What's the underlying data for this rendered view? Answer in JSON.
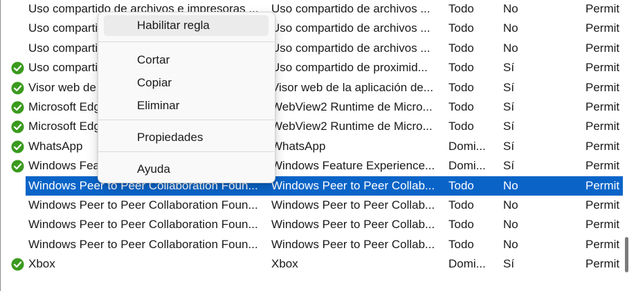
{
  "rule_list": {
    "rows": [
      {
        "name": "Uso compartido de archivos e impresoras ...",
        "group": "Uso compartido de archivos ...",
        "profile": "Todo",
        "enabled": "No",
        "action": "Permit",
        "enabled_icon": "",
        "selected": false
      },
      {
        "name": "Uso compartido de archivos e impresoras ...",
        "group": "Uso compartido de archivos ...",
        "profile": "Todo",
        "enabled": "No",
        "action": "Permit",
        "enabled_icon": "",
        "selected": false
      },
      {
        "name": "Uso compartido de archivos e impresoras ...",
        "group": "Uso compartido de archivos ...",
        "profile": "Todo",
        "enabled": "No",
        "action": "Permit",
        "enabled_icon": "",
        "selected": false
      },
      {
        "name": "Uso compartido de proximidad ...",
        "group": "Uso compartido de proximid...",
        "profile": "Todo",
        "enabled": "Sí",
        "action": "Permit",
        "enabled_icon": "green-check-icon",
        "selected": false
      },
      {
        "name": "Visor web de la aplicación de escritorio",
        "group": "Visor web de la aplicación de...",
        "profile": "Todo",
        "enabled": "Sí",
        "action": "Permit",
        "enabled_icon": "green-check-icon",
        "selected": false
      },
      {
        "name": "Microsoft Edge WebView2",
        "group": "WebView2 Runtime de Micro...",
        "profile": "Todo",
        "enabled": "Sí",
        "action": "Permit",
        "enabled_icon": "green-check-icon",
        "selected": false
      },
      {
        "name": "Microsoft Edge WebView2",
        "group": "WebView2 Runtime de Micro...",
        "profile": "Todo",
        "enabled": "Sí",
        "action": "Permit",
        "enabled_icon": "green-check-icon",
        "selected": false
      },
      {
        "name": "WhatsApp",
        "group": "WhatsApp",
        "profile": "Domi...",
        "enabled": "Sí",
        "action": "Permit",
        "enabled_icon": "green-check-icon",
        "selected": false
      },
      {
        "name": "Windows Feature Experience Pack",
        "group": "Windows Feature Experience...",
        "profile": "Domi...",
        "enabled": "Sí",
        "action": "Permit",
        "enabled_icon": "green-check-icon",
        "selected": false
      },
      {
        "name": "Windows Peer to Peer Collaboration Foun...",
        "group": "Windows Peer to Peer Collab...",
        "profile": "Todo",
        "enabled": "No",
        "action": "Permit",
        "enabled_icon": "",
        "selected": true
      },
      {
        "name": "Windows Peer to Peer Collaboration Foun...",
        "group": "Windows Peer to Peer Collab...",
        "profile": "Todo",
        "enabled": "No",
        "action": "Permit",
        "enabled_icon": "",
        "selected": false
      },
      {
        "name": "Windows Peer to Peer Collaboration Foun...",
        "group": "Windows Peer to Peer Collab...",
        "profile": "Todo",
        "enabled": "No",
        "action": "Permit",
        "enabled_icon": "",
        "selected": false
      },
      {
        "name": "Windows Peer to Peer Collaboration Foun...",
        "group": "Windows Peer to Peer Collab...",
        "profile": "Todo",
        "enabled": "No",
        "action": "Permit",
        "enabled_icon": "",
        "selected": false
      },
      {
        "name": "Xbox",
        "group": "Xbox",
        "profile": "Domi...",
        "enabled": "Sí",
        "action": "Permit",
        "enabled_icon": "green-check-icon",
        "selected": false
      }
    ]
  },
  "context_menu": {
    "enable_rule": "Habilitar regla",
    "cut": "Cortar",
    "copy": "Copiar",
    "delete": "Eliminar",
    "properties": "Propiedades",
    "help": "Ayuda"
  },
  "colors": {
    "selection": "#0a64c8",
    "check_green": "#3a9a1e"
  }
}
